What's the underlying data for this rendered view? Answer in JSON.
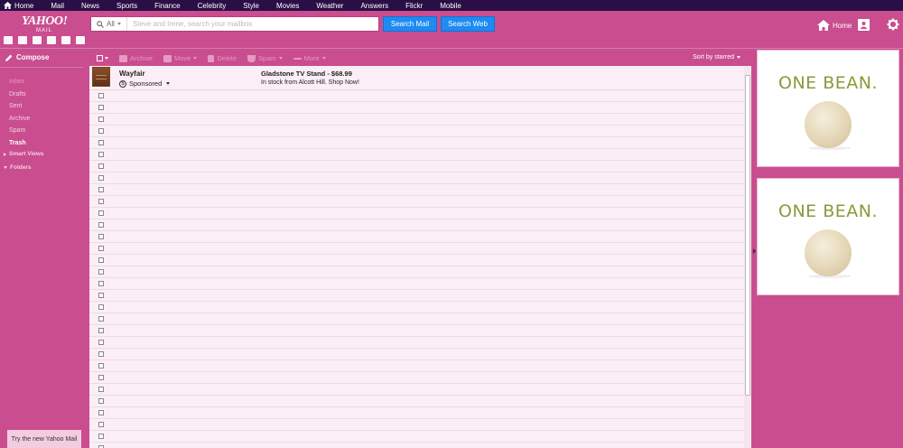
{
  "topnav": {
    "items": [
      "Home",
      "Mail",
      "News",
      "Sports",
      "Finance",
      "Celebrity",
      "Style",
      "Movies",
      "Weather",
      "Answers",
      "Flickr",
      "Mobile"
    ]
  },
  "header": {
    "logo_text": "YAHOO!",
    "logo_sub": "MAIL",
    "search_scope": "All",
    "search_placeholder": "Steve and Irene, search your mailbox",
    "search_mail_label": "Search Mail",
    "search_web_label": "Search Web",
    "home_label": "Home"
  },
  "sidebar": {
    "compose_label": "Compose",
    "folders": [
      "Inbox",
      "Drafts",
      "Sent",
      "Archive",
      "Spam",
      "Trash"
    ],
    "active_folder": "Trash",
    "smart_views_label": "Smart Views",
    "folders_label": "Folders",
    "try_new_label": "Try the new Yahoo Mail"
  },
  "toolbar": {
    "archive_label": "Archive",
    "move_label": "Move",
    "delete_label": "Delete",
    "spam_label": "Spam",
    "more_label": "More",
    "sort_label": "Sort by starred"
  },
  "ad_message": {
    "sender": "Wayfair",
    "sponsored_label": "Sponsored",
    "subject": "Gladstone TV Stand - $68.99",
    "snippet": "In stock from Alcott Hill. Shop Now!"
  },
  "side_ads": {
    "text": "ONE BEAN."
  },
  "colors": {
    "topnav_bg": "#2a0f46",
    "theme_bg": "#c94d8f",
    "search_button": "#1d8bf1",
    "ad_text": "#8a9a3a"
  }
}
